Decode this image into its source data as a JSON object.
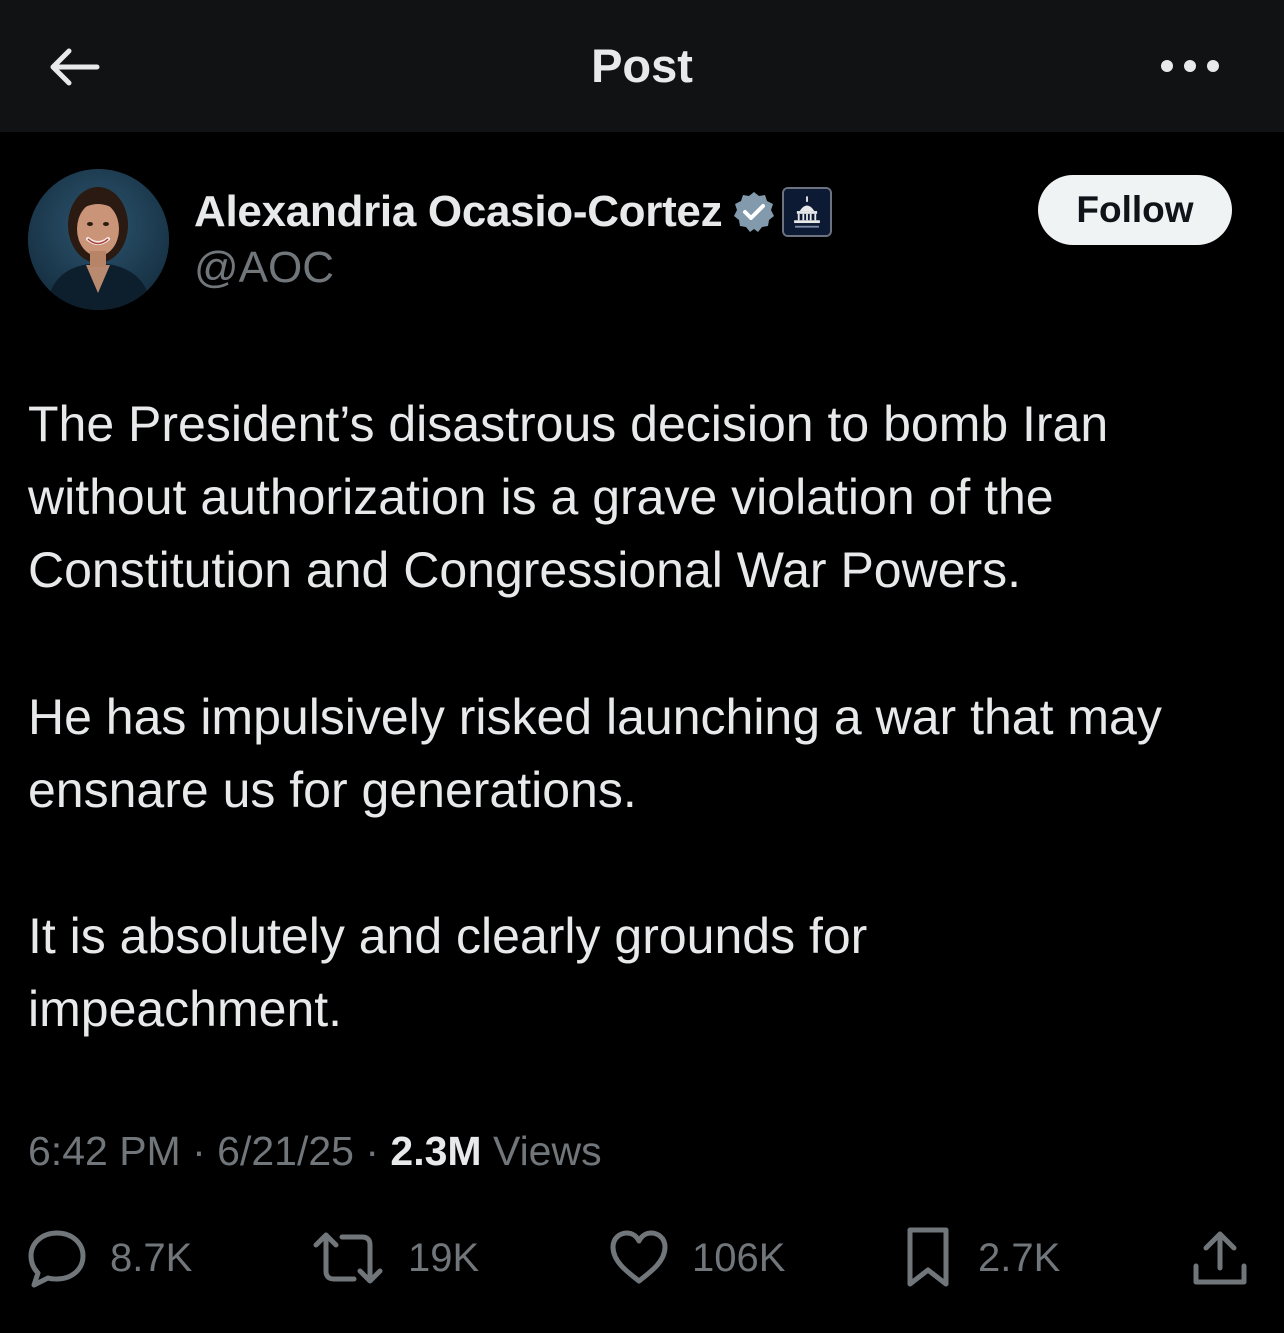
{
  "header": {
    "title": "Post",
    "back_icon": "arrow-left-icon",
    "more_icon": "more-horizontal-icon"
  },
  "author": {
    "display_name": "Alexandria Ocasio-Cortez",
    "handle": "@AOC",
    "verified_icon": "verified-badge-icon",
    "affiliation_icon": "capitol-affiliation-badge-icon"
  },
  "follow_button": {
    "label": "Follow"
  },
  "post": {
    "paragraphs": [
      [
        "The President’s disastrous decision to bomb Iran",
        "without authorization is a grave violation of the",
        "Constitution and Congressional War Powers."
      ],
      [
        "He has impulsively risked launching a war that may",
        "ensnare us for generations."
      ],
      [
        "It is absolutely and clearly grounds for",
        "impeachment."
      ]
    ],
    "time": "6:42 PM",
    "date": "6/21/25",
    "views_count": "2.3M",
    "views_label": "Views",
    "separator": "·"
  },
  "actions": {
    "reply": {
      "icon": "reply-icon",
      "count": "8.7K"
    },
    "repost": {
      "icon": "repost-icon",
      "count": "19K"
    },
    "like": {
      "icon": "heart-icon",
      "count": "106K"
    },
    "bookmark": {
      "icon": "bookmark-icon",
      "count": "2.7K"
    },
    "share": {
      "icon": "share-icon"
    }
  },
  "colors": {
    "background": "#000000",
    "header_background": "#111214",
    "text_primary": "#e7e9ea",
    "text_secondary": "#71767b",
    "verified_blue": "#829aab",
    "follow_button_bg": "#eff3f4"
  }
}
